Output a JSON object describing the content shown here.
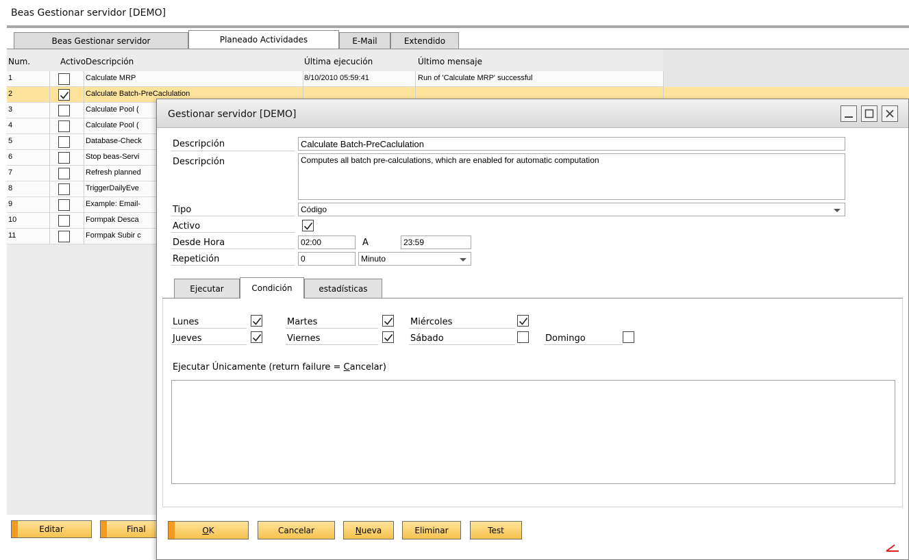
{
  "main": {
    "title": "Beas Gestionar servidor [DEMO]",
    "tabs": [
      {
        "label": "Beas Gestionar servidor"
      },
      {
        "label": "Planeado Actividades"
      },
      {
        "label": "E-Mail"
      },
      {
        "label": "Extendido"
      }
    ],
    "grid": {
      "headers": {
        "num": "Num.",
        "activo": "Activo",
        "descripcion": "Descripción",
        "ultima": "Última ejecución",
        "mensaje": "Último mensaje"
      },
      "rows": [
        {
          "num": "1",
          "active": false,
          "desc": "Calculate MRP",
          "last": "8/10/2010 05:59:41",
          "msg": "Run of 'Calculate MRP' successful"
        },
        {
          "num": "2",
          "active": true,
          "desc": "Calculate Batch-PreCaclulation",
          "last": "",
          "msg": "",
          "selected": true
        },
        {
          "num": "3",
          "active": false,
          "desc": "Calculate Pool (",
          "last": "",
          "msg": ""
        },
        {
          "num": "4",
          "active": false,
          "desc": "Calculate Pool (",
          "last": "",
          "msg": ""
        },
        {
          "num": "5",
          "active": false,
          "desc": "Database-Check",
          "last": "",
          "msg": ""
        },
        {
          "num": "6",
          "active": false,
          "desc": "Stop beas-Servi",
          "last": "",
          "msg": ""
        },
        {
          "num": "7",
          "active": false,
          "desc": "Refresh planned",
          "last": "",
          "msg": ""
        },
        {
          "num": "8",
          "active": false,
          "desc": "TriggerDailyEve",
          "last": "",
          "msg": ""
        },
        {
          "num": "9",
          "active": false,
          "desc": "Example: Email-",
          "last": "",
          "msg": ""
        },
        {
          "num": "10",
          "active": false,
          "desc": "Formpak Desca",
          "last": "",
          "msg": ""
        },
        {
          "num": "11",
          "active": false,
          "desc": "Formpak Subir c",
          "last": "",
          "msg": ""
        }
      ]
    },
    "buttons": {
      "editar": "Editar",
      "final": "Final"
    }
  },
  "dialog": {
    "title": "Gestionar servidor [DEMO]",
    "labels": {
      "descripcion1": "Descripción",
      "descripcion2": "Descripción",
      "tipo": "Tipo",
      "activo": "Activo",
      "desde": "Desde Hora",
      "a": "A",
      "repeticion": "Repetición"
    },
    "values": {
      "descripcion": "Calculate Batch-PreCaclulation",
      "descripcion_long": "Computes all batch pre-calculations, which are enabled for automatic computation",
      "tipo": "Código",
      "activo": true,
      "desde": "02:00",
      "hasta": "23:59",
      "repeticion": "0",
      "repeticion_unit": "Minuto"
    },
    "tabs": [
      {
        "label": "Ejecutar"
      },
      {
        "label": "Condición"
      },
      {
        "label": "estadísticas"
      }
    ],
    "days": [
      {
        "label": "Lunes",
        "checked": true
      },
      {
        "label": "Martes",
        "checked": true
      },
      {
        "label": "Miércoles",
        "checked": true
      },
      {
        "label": "Jueves",
        "checked": true
      },
      {
        "label": "Viernes",
        "checked": true
      },
      {
        "label": "Sábado",
        "checked": false
      },
      {
        "label": "Domingo",
        "checked": false
      }
    ],
    "exec_label_pre": "Ejecutar Únicamente (return failure = ",
    "exec_label_u": "C",
    "exec_label_post": "ancelar)",
    "buttons": {
      "ok_u": "O",
      "ok_rest": "K",
      "cancelar": "Cancelar",
      "nueva_u": "N",
      "nueva_rest": "ueva",
      "eliminar": "Eliminar",
      "test": "Test"
    }
  },
  "colors": {
    "selected_row": "#fde39b",
    "button": "#f6c24d",
    "button_accent": "#f39a21"
  }
}
